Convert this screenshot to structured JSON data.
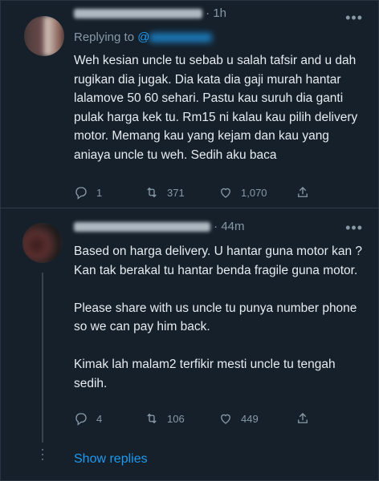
{
  "tweets": [
    {
      "time": "1h",
      "replying_label": "Replying to",
      "replying_handle": "@",
      "text": "Weh kesian uncle tu sebab u salah tafsir and u dah rugikan dia jugak. Dia kata dia gaji murah hantar lalamove 50 60 sehari. Pastu kau suruh dia ganti pulak harga kek tu. Rm15 ni kalau kau pilih delivery motor. Memang kau yang kejam dan kau yang aniaya uncle tu weh. Sedih aku baca",
      "replies": "1",
      "retweets": "371",
      "likes": "1,070"
    },
    {
      "time": "44m",
      "text": "Based on harga delivery. U hantar guna motor kan ? Kan tak berakal tu hantar benda fragile guna motor.\n\nPlease share with us uncle tu punya number phone so we can pay him back.\n\nKimak lah malam2 terfikir mesti uncle tu tengah sedih.",
      "replies": "4",
      "retweets": "106",
      "likes": "449"
    }
  ],
  "more_label": "•••",
  "time_sep": "·",
  "show_replies": "Show replies",
  "colors": {
    "background": "#15202b",
    "accent": "#1d9bf0",
    "muted": "#8899a6",
    "text": "#e6ecf0"
  }
}
